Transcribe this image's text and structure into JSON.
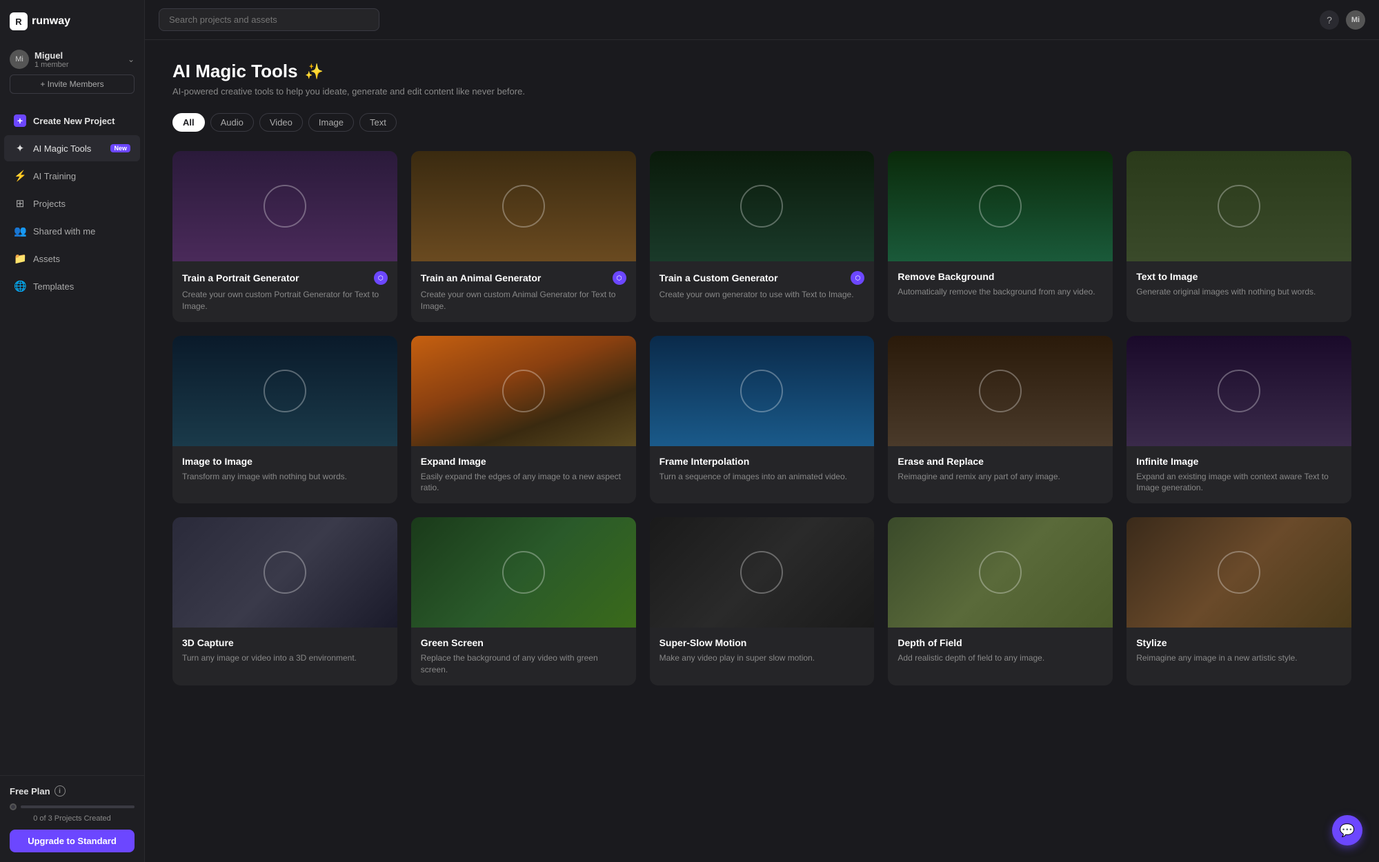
{
  "sidebar": {
    "logo": "runway",
    "logo_abbr": "R",
    "user": {
      "name": "Miguel",
      "member_count": "1 member",
      "avatar": "Mi"
    },
    "invite_button": "+ Invite Members",
    "nav_items": [
      {
        "id": "create-new-project",
        "label": "Create New Project",
        "icon": "plus-square",
        "active": false
      },
      {
        "id": "ai-magic-tools",
        "label": "AI Magic Tools",
        "icon": "sparkles",
        "active": true,
        "badge": "New"
      },
      {
        "id": "ai-training",
        "label": "AI Training",
        "icon": "bolt",
        "active": false
      },
      {
        "id": "projects",
        "label": "Projects",
        "icon": "grid",
        "active": false
      },
      {
        "id": "shared-with-me",
        "label": "Shared with me",
        "icon": "users",
        "active": false
      },
      {
        "id": "assets",
        "label": "Assets",
        "icon": "folder",
        "active": false
      },
      {
        "id": "templates",
        "label": "Templates",
        "icon": "globe",
        "active": false
      }
    ],
    "bottom": {
      "plan_label": "Free Plan",
      "projects_count": "0 of 3 Projects Created",
      "upgrade_button": "Upgrade to Standard"
    }
  },
  "topbar": {
    "search_placeholder": "Search projects and assets",
    "avatar": "Mi"
  },
  "main": {
    "title": "AI Magic Tools",
    "title_icon": "✨",
    "subtitle": "AI-powered creative tools to help you ideate, generate and edit content like never before.",
    "filter_tabs": [
      {
        "id": "all",
        "label": "All",
        "active": true
      },
      {
        "id": "audio",
        "label": "Audio",
        "active": false
      },
      {
        "id": "video",
        "label": "Video",
        "active": false
      },
      {
        "id": "image",
        "label": "Image",
        "active": false
      },
      {
        "id": "text",
        "label": "Text",
        "active": false
      }
    ],
    "tools": [
      {
        "id": "train-portrait",
        "title": "Train a Portrait Generator",
        "description": "Create your own custom Portrait Generator for Text to Image.",
        "bg_class": "portrait-card",
        "has_badge": true
      },
      {
        "id": "train-animal",
        "title": "Train an Animal Generator",
        "description": "Create your own custom Animal Generator for Text to Image.",
        "bg_class": "animal-card",
        "has_badge": true
      },
      {
        "id": "train-custom",
        "title": "Train a Custom Generator",
        "description": "Create your own generator to use with Text to Image.",
        "bg_class": "custom-card",
        "has_badge": true
      },
      {
        "id": "remove-background",
        "title": "Remove Background",
        "description": "Automatically remove the background from any video.",
        "bg_class": "removebg-card",
        "has_badge": false
      },
      {
        "id": "text-to-image",
        "title": "Text to Image",
        "description": "Generate original images with nothing but words.",
        "bg_class": "texttoimg-card",
        "has_badge": false
      },
      {
        "id": "image-to-image",
        "title": "Image to Image",
        "description": "Transform any image with nothing but words.",
        "bg_class": "imgtoimg-card",
        "has_badge": false
      },
      {
        "id": "expand-image",
        "title": "Expand Image",
        "description": "Easily expand the edges of any image to a new aspect ratio.",
        "bg_class": "expand-card",
        "has_badge": false
      },
      {
        "id": "frame-interpolation",
        "title": "Frame Interpolation",
        "description": "Turn a sequence of images into an animated video.",
        "bg_class": "frameinterp-card",
        "has_badge": false
      },
      {
        "id": "erase-and-replace",
        "title": "Erase and Replace",
        "description": "Reimagine and remix any part of any image.",
        "bg_class": "erasereplace-card",
        "has_badge": false
      },
      {
        "id": "infinite-image",
        "title": "Infinite Image",
        "description": "Expand an existing image with context aware Text to Image generation.",
        "bg_class": "infinite-card",
        "has_badge": false
      },
      {
        "id": "tool-row3-1",
        "title": "3D Capture",
        "description": "Turn any image or video into a 3D environment.",
        "bg_class": "bg-row3-1",
        "has_badge": false
      },
      {
        "id": "tool-row3-2",
        "title": "Green Screen",
        "description": "Replace the background of any video with green screen.",
        "bg_class": "bg-row3-2",
        "has_badge": false
      },
      {
        "id": "tool-row3-3",
        "title": "Super-Slow Motion",
        "description": "Make any video play in super slow motion.",
        "bg_class": "bg-row3-3",
        "has_badge": false
      },
      {
        "id": "tool-row3-4",
        "title": "Depth of Field",
        "description": "Add realistic depth of field to any image.",
        "bg_class": "bg-row3-4",
        "has_badge": false
      },
      {
        "id": "tool-row3-5",
        "title": "Stylize",
        "description": "Reimagine any image in a new artistic style.",
        "bg_class": "bg-row3-5",
        "has_badge": false
      }
    ]
  }
}
